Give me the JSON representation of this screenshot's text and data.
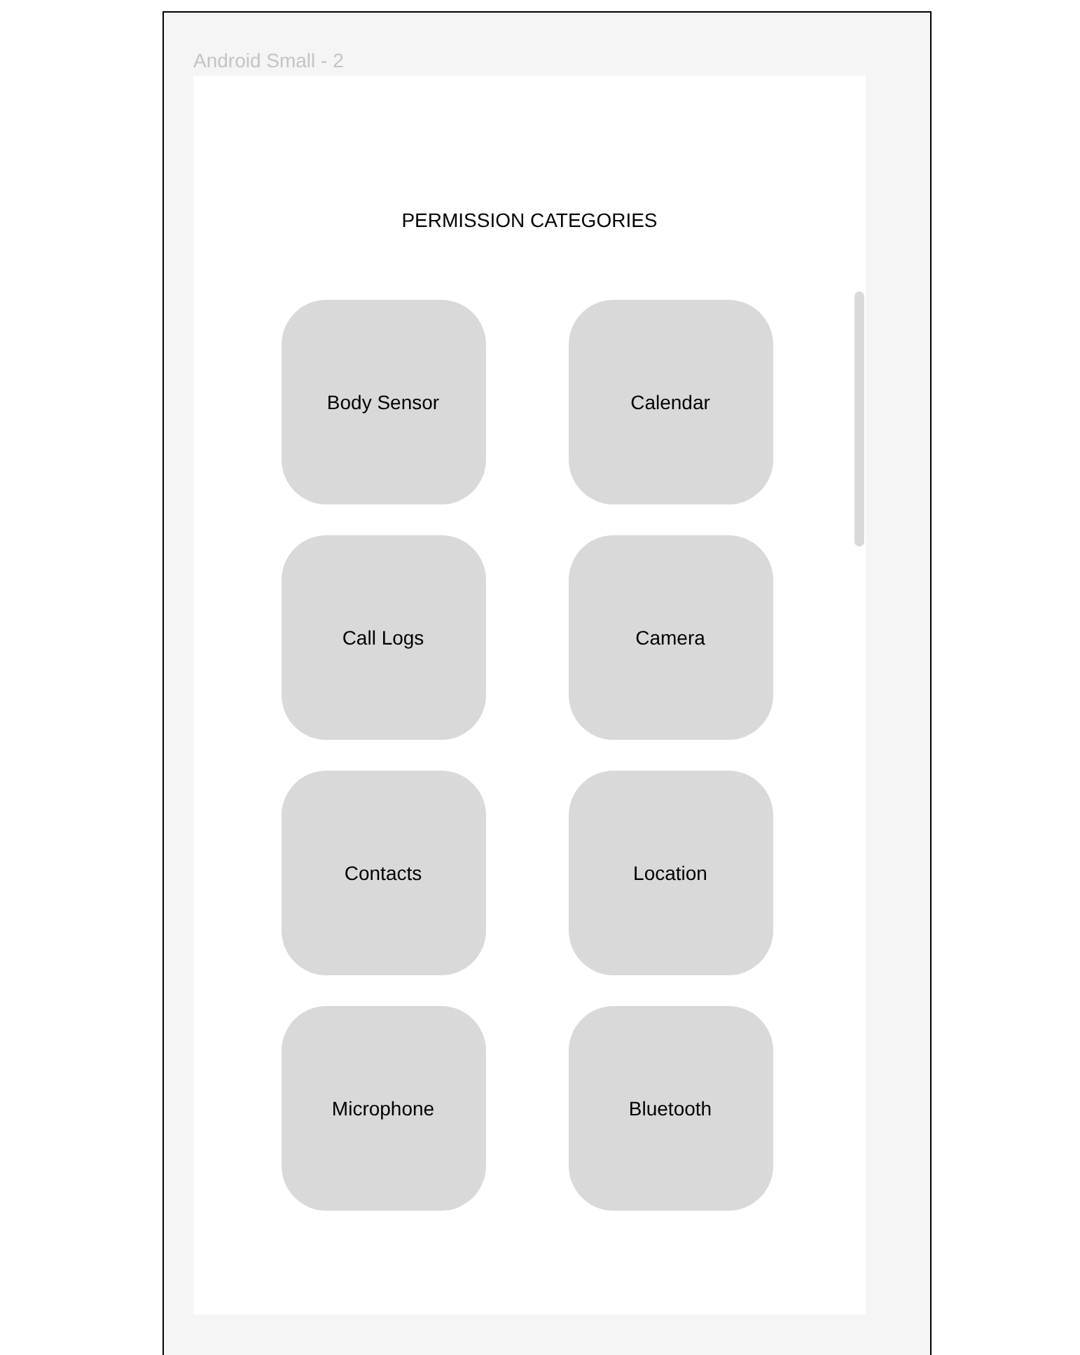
{
  "frame": {
    "label": "Android Small - 2"
  },
  "screen": {
    "title": "PERMISSION CATEGORIES",
    "categories": [
      {
        "label": "Body Sensor"
      },
      {
        "label": "Calendar"
      },
      {
        "label": "Call Logs"
      },
      {
        "label": "Camera"
      },
      {
        "label": "Contacts"
      },
      {
        "label": "Location"
      },
      {
        "label": "Microphone"
      },
      {
        "label": "Bluetooth"
      }
    ]
  }
}
